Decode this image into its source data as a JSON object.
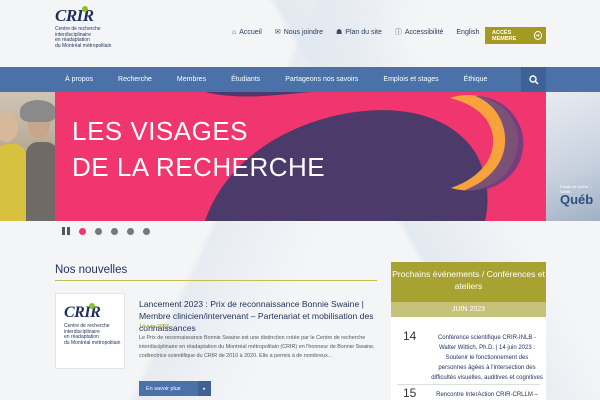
{
  "logo": {
    "mark": "CRIR",
    "lines": [
      "Centre de recherche",
      "interdisciplinaire",
      "en réadaptation",
      "du Montréal métropolitain"
    ]
  },
  "topnav": {
    "items": [
      {
        "icon": "home-icon",
        "glyph": "⌂",
        "label": "Accueil"
      },
      {
        "icon": "envelope-icon",
        "glyph": "✉",
        "label": "Nous joindre"
      },
      {
        "icon": "sitemap-icon",
        "glyph": "☗",
        "label": "Plan du site"
      },
      {
        "icon": "info-icon",
        "glyph": "ⓘ",
        "label": "Accessibilité"
      },
      {
        "icon": "",
        "glyph": "",
        "label": "English"
      }
    ],
    "member_button": "ACCÈS MEMBRE",
    "member_icon": "arrow-circle-icon"
  },
  "mainnav": {
    "items": [
      "À propos",
      "Recherche",
      "Membres",
      "Étudiants",
      "Partageons nos savoirs",
      "Emplois et stages",
      "Éthique"
    ],
    "search_icon": "search-icon"
  },
  "banner": {
    "line1": "LES VISAGES",
    "line2": "DE LA RECHERCHE",
    "colors": {
      "background": "#f0356f",
      "shape": "#4b3a6a",
      "accent": "#f7a23b"
    },
    "right_panel_text": "Québ",
    "right_panel_small": "Fonds de reche… Santé"
  },
  "slider": {
    "dots": 5,
    "active_index": 0
  },
  "news": {
    "heading": "Nos nouvelles",
    "item": {
      "title": "Lancement 2023 : Prix de reconnaissance Bonnie Swaine | Membre clinicien/intervenant – Partenariat et mobilisation des connaissances",
      "date": "14 juin 2023",
      "body": "Le Prix de reconnaissance Bonnie Swaine est une distinction créée par le Centre de recherche interdisciplinaire en réadaptation du Montréal métropolitain (CRIR) en l'honneur de Bonnie Swaine, codirectrice scientifique du CRIR de 2010 à 2020. Elle a permis à de nombreux…",
      "button": "En savoir plus"
    }
  },
  "events": {
    "heading": "Prochains événements / Conférences et ateliers",
    "month": "JUIN 2023",
    "items": [
      {
        "day": "14",
        "text": "Conférence scientifique CRIR-INLB - Walter Wittich, Ph.D. | 14 juin 2023 : Soutenir le fonctionnement des personnes âgées à l'intersection des difficultés visuelles, auditives et cognitives"
      },
      {
        "day": "15",
        "text": "Rencontre InterAction CRIR-CRLLM –"
      }
    ]
  },
  "colors": {
    "nav_blue": "#4a72a8",
    "olive": "#a39a1f",
    "pink": "#f0356f",
    "navy": "#1f2f5c"
  }
}
